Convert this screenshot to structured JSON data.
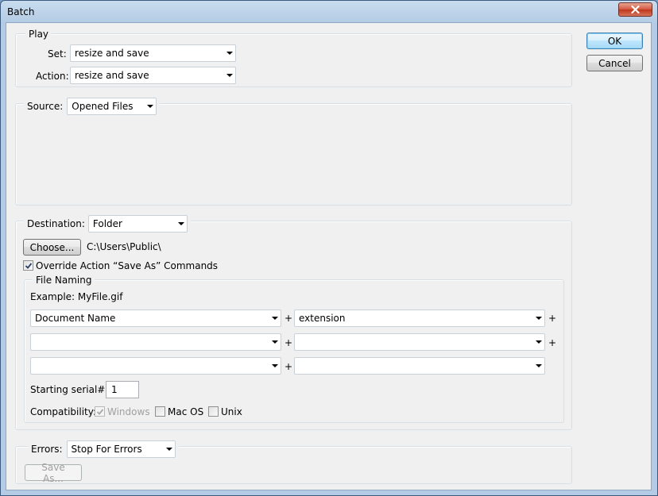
{
  "window": {
    "title": "Batch"
  },
  "buttons": {
    "ok": "OK",
    "cancel": "Cancel",
    "choose": "Choose...",
    "save_as": "Save As..."
  },
  "play": {
    "label": "Play",
    "set_label": "Set:",
    "set_value": "resize and save",
    "action_label": "Action:",
    "action_value": "resize and save"
  },
  "source": {
    "label": "Source:",
    "value": "Opened Files"
  },
  "destination": {
    "label": "Destination:",
    "value": "Folder",
    "path": "C:\\Users\\Public\\",
    "override_label": "Override Action “Save As” Commands",
    "override_checked": true
  },
  "file_naming": {
    "label": "File Naming",
    "example": "Example: MyFile.gif",
    "fields": [
      [
        "Document Name",
        "extension"
      ],
      [
        "",
        ""
      ],
      [
        "",
        ""
      ]
    ],
    "plus": "+",
    "serial_label": "Starting serial#:",
    "serial_value": "1",
    "compat_label": "Compatibility:",
    "compat": [
      {
        "label": "Windows",
        "checked": true,
        "disabled": true
      },
      {
        "label": "Mac OS",
        "checked": false,
        "disabled": false
      },
      {
        "label": "Unix",
        "checked": false,
        "disabled": false
      }
    ]
  },
  "errors": {
    "label": "Errors:",
    "value": "Stop For Errors"
  }
}
